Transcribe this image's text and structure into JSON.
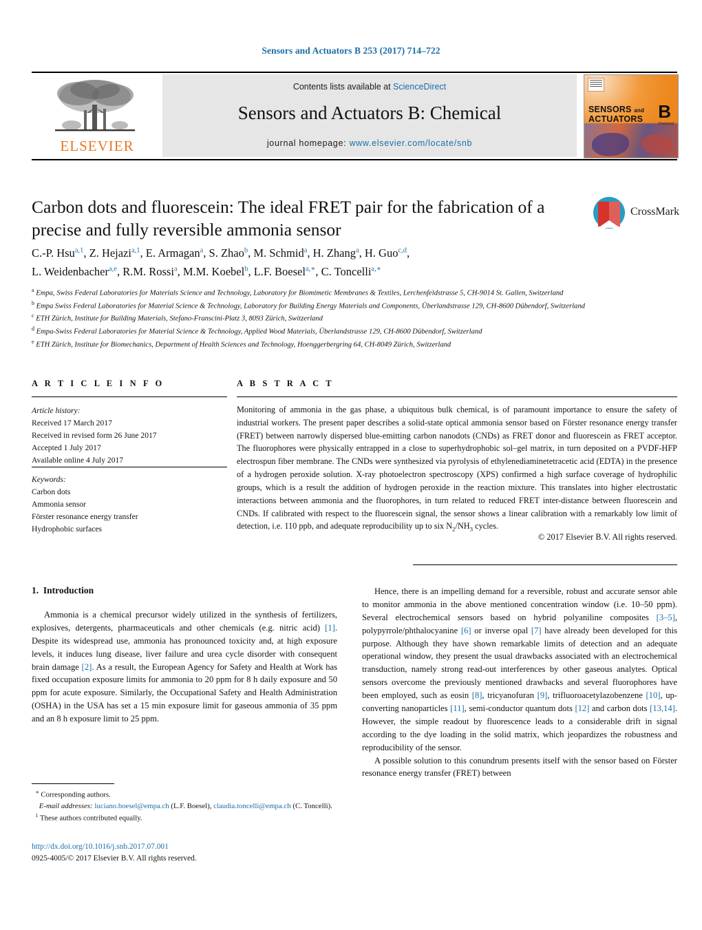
{
  "running_head": "Sensors and Actuators B 253 (2017) 714–722",
  "banner": {
    "contents_prefix": "Contents lists available at ",
    "contents_link": "ScienceDirect",
    "journal_title": "Sensors and Actuators B: Chemical",
    "homepage_prefix": "journal homepage: ",
    "homepage_link": "www.elsevier.com/locate/snb",
    "publisher_logo_text": "ELSEVIER",
    "cover": {
      "line1": "SENSORS",
      "line1_small": "and",
      "line2": "ACTUATORS",
      "letter": "B",
      "letter_sub": "Chemical"
    }
  },
  "crossmark": {
    "label": "CrossMark"
  },
  "article": {
    "title": "Carbon dots and fluorescein: The ideal FRET pair for the fabrication of a precise and fully reversible ammonia sensor",
    "authors_line1": "C.-P. Hsu, Z. Hejazi, E. Armagan, S. Zhao, M. Schmid, H. Zhang, H. Guo,",
    "authors_line2": "L. Weidenbacher, R.M. Rossi, M.M. Koebel, L.F. Boesel, C. Toncelli",
    "authors": [
      {
        "name": "C.-P. Hsu",
        "sup": "a,1"
      },
      {
        "name": "Z. Hejazi",
        "sup": "a,1"
      },
      {
        "name": "E. Armagan",
        "sup": "a"
      },
      {
        "name": "S. Zhao",
        "sup": "b"
      },
      {
        "name": "M. Schmid",
        "sup": "a"
      },
      {
        "name": "H. Zhang",
        "sup": "a"
      },
      {
        "name": "H. Guo",
        "sup": "c,d"
      },
      {
        "name": "L. Weidenbacher",
        "sup": "a,e"
      },
      {
        "name": "R.M. Rossi",
        "sup": "a"
      },
      {
        "name": "M.M. Koebel",
        "sup": "b"
      },
      {
        "name": "L.F. Boesel",
        "sup": "a,*"
      },
      {
        "name": "C. Toncelli",
        "sup": "a,*"
      }
    ],
    "affiliations": [
      {
        "key": "a",
        "text": "Empa, Swiss Federal Laboratories for Materials Science and Technology, Laboratory for Biomimetic Membranes & Textiles, Lerchenfeldstrasse 5, CH-9014 St. Gallen, Switzerland"
      },
      {
        "key": "b",
        "text": "Empa Swiss Federal Laboratories for Material Science & Technology, Laboratory for Building Energy Materials and Components, Überlandstrasse 129, CH-8600 Dübendorf, Switzerland"
      },
      {
        "key": "c",
        "text": "ETH Zürich, Institute for Building Materials, Stefano-Franscini-Platz 3, 8093 Zürich, Switzerland"
      },
      {
        "key": "d",
        "text": "Empa-Swiss Federal Laboratories for Material Science & Technology, Applied Wood Materials, Überlandstrasse 129, CH-8600 Dübendorf, Switzerland"
      },
      {
        "key": "e",
        "text": "ETH Zürich, Institute for Biomechanics, Department of Health Sciences and Technology, Hoenggerbergring 64, CH-8049 Zürich, Switzerland"
      }
    ]
  },
  "article_info": {
    "heading": "A R T I C L E   I N F O",
    "history_label": "Article history:",
    "history": [
      "Received 17 March 2017",
      "Received in revised form 26 June 2017",
      "Accepted 1 July 2017",
      "Available online 4 July 2017"
    ],
    "keywords_label": "Keywords:",
    "keywords": [
      "Carbon dots",
      "Ammonia sensor",
      "Förster resonance energy transfer",
      "Hydrophobic surfaces"
    ]
  },
  "abstract": {
    "heading": "A B S T R A C T",
    "text": "Monitoring of ammonia in the gas phase, a ubiquitous bulk chemical, is of paramount importance to ensure the safety of industrial workers. The present paper describes a solid-state optical ammonia sensor based on Förster resonance energy transfer (FRET) between narrowly dispersed blue-emitting carbon nanodots (CNDs) as FRET donor and fluorescein as FRET acceptor. The fluorophores were physically entrapped in a close to superhydrophobic sol–gel matrix, in turn deposited on a PVDF-HFP electrospun fiber membrane. The CNDs were synthesized via pyrolysis of ethylenediaminetetracetic acid (EDTA) in the presence of a hydrogen peroxide solution. X-ray photoelectron spectroscopy (XPS) confirmed a high surface coverage of hydrophilic groups, which is a result the addition of hydrogen peroxide in the reaction mixture. This translates into higher electrostatic interactions between ammonia and the fluorophores, in turn related to reduced FRET inter-distance between fluorescein and CNDs. If calibrated with respect to the fluorescein signal, the sensor shows a linear calibration with a remarkably low limit of detection, i.e. 110 ppb, and adequate reproducibility up to six N2/NH3 cycles.",
    "copyright": "© 2017 Elsevier B.V. All rights reserved."
  },
  "body": {
    "section_number": "1.",
    "section_title": "Introduction",
    "left_paragraph": "Ammonia is a chemical precursor widely utilized in the synthesis of fertilizers, explosives, detergents, pharmaceuticals and other chemicals (e.g. nitric acid) [1]. Despite its widespread use, ammonia has pronounced toxicity and, at high exposure levels, it induces lung disease, liver failure and urea cycle disorder with consequent brain damage [2]. As a result, the European Agency for Safety and Health at Work has fixed occupation exposure limits for ammonia to 20 ppm for 8 h daily exposure and 50 ppm for acute exposure. Similarly, the Occupational Safety and Health Administration (OSHA) in the USA has set a 15 min exposure limit for gaseous ammonia of 35 ppm and an 8 h exposure limit to 25 ppm.",
    "right_paragraph_1": "Hence, there is an impelling demand for a reversible, robust and accurate sensor able to monitor ammonia in the above mentioned concentration window (i.e. 10–50 ppm). Several electrochemical sensors based on hybrid polyaniline composites [3–5], polypyrrole/phthalocyanine [6] or inverse opal [7] have already been developed for this purpose. Although they have shown remarkable limits of detection and an adequate operational window, they present the usual drawbacks associated with an electrochemical transduction, namely strong read-out interferences by other gaseous analytes. Optical sensors overcome the previously mentioned drawbacks and several fluorophores have been employed, such as eosin [8], tricyanofuran [9], trifluoroacetylazobenzene [10], up-converting nanoparticles [11], semi-conductor quantum dots [12] and carbon dots [13,14]. However, the simple readout by fluorescence leads to a considerable drift in signal according to the dye loading in the solid matrix, which jeopardizes the robustness and reproducibility of the sensor.",
    "right_paragraph_2": "A possible solution to this conundrum presents itself with the sensor based on Förster resonance energy transfer (FRET) between"
  },
  "footnotes": {
    "corresponding": "Corresponding authors.",
    "email_label": "E-mail addresses:",
    "email1": "luciano.boesel@empa.ch",
    "email1_owner": "(L.F. Boesel),",
    "email2": "claudia.toncelli@empa.ch",
    "email2_owner": "(C. Toncelli).",
    "equal_contrib": "These authors contributed equally.",
    "doi_url": "http://dx.doi.org/10.1016/j.snb.2017.07.001",
    "issn_line": "0925-4005/© 2017 Elsevier B.V. All rights reserved."
  },
  "colors": {
    "link_blue": "#1a6ea8",
    "elsevier_orange": "#E87722",
    "banner_grey": "#e6e6e6",
    "crossmark_red": "#d6332b",
    "crossmark_teal": "#2b9bbf"
  }
}
